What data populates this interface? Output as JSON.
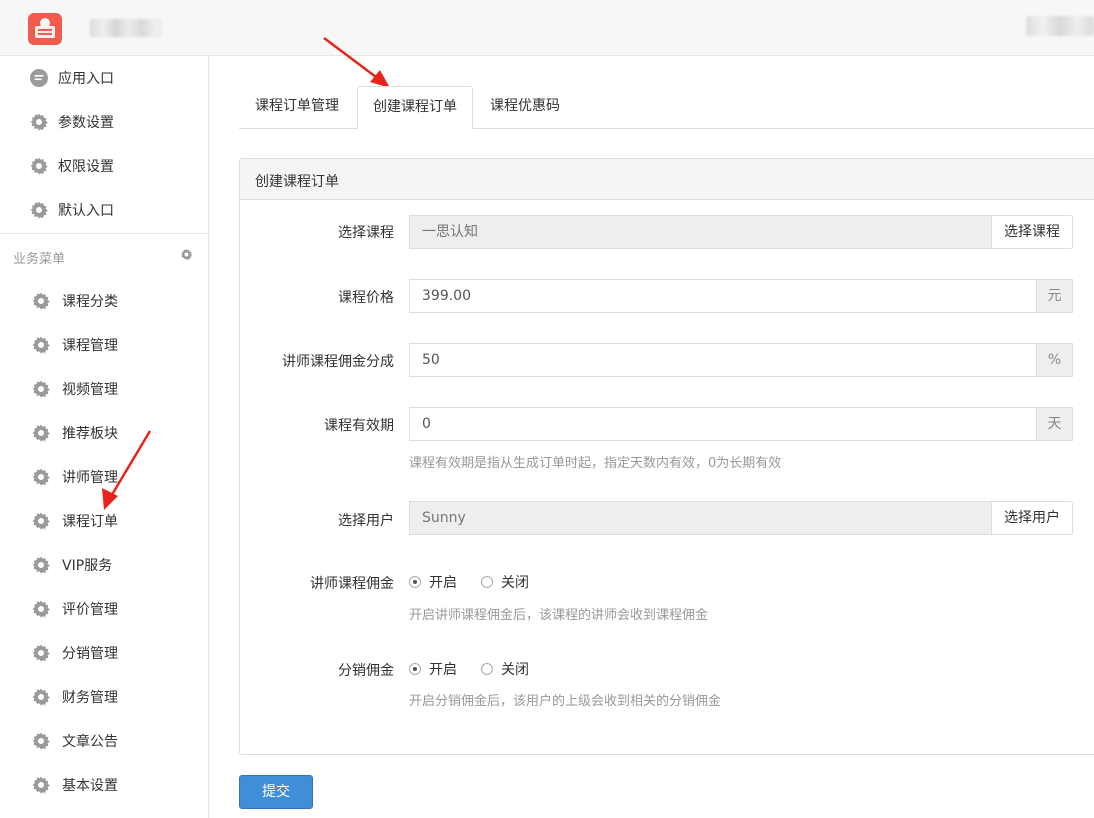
{
  "sidebar": {
    "top_items": [
      {
        "label": "应用入口",
        "icon": "chat-bubble-icon"
      },
      {
        "label": "参数设置",
        "icon": "gear-icon"
      },
      {
        "label": "权限设置",
        "icon": "gear-icon"
      },
      {
        "label": "默认入口",
        "icon": "gear-icon"
      }
    ],
    "section_title": "业务菜单",
    "business_items": [
      {
        "label": "课程分类"
      },
      {
        "label": "课程管理"
      },
      {
        "label": "视频管理"
      },
      {
        "label": "推荐板块"
      },
      {
        "label": "讲师管理"
      },
      {
        "label": "课程订单"
      },
      {
        "label": "VIP服务"
      },
      {
        "label": "评价管理"
      },
      {
        "label": "分销管理"
      },
      {
        "label": "财务管理"
      },
      {
        "label": "文章公告"
      },
      {
        "label": "基本设置"
      }
    ]
  },
  "tabs": [
    {
      "label": "课程订单管理",
      "active": false
    },
    {
      "label": "创建课程订单",
      "active": true
    },
    {
      "label": "课程优惠码",
      "active": false
    }
  ],
  "panel": {
    "title": "创建课程订单"
  },
  "form": {
    "course": {
      "label": "选择课程",
      "value": "一思认知",
      "button": "选择课程"
    },
    "price": {
      "label": "课程价格",
      "value": "399.00",
      "unit": "元"
    },
    "commission_ratio": {
      "label": "讲师课程佣金分成",
      "value": "50",
      "unit": "%"
    },
    "validity": {
      "label": "课程有效期",
      "value": "0",
      "unit": "天",
      "help": "课程有效期是指从生成订单时起，指定天数内有效，0为长期有效"
    },
    "user": {
      "label": "选择用户",
      "value": "Sunny",
      "button": "选择用户"
    },
    "teacher_commission": {
      "label": "讲师课程佣金",
      "on": "开启",
      "off": "关闭",
      "selected": "on",
      "help": "开启讲师课程佣金后，该课程的讲师会收到课程佣金"
    },
    "distribution_commission": {
      "label": "分销佣金",
      "on": "开启",
      "off": "关闭",
      "selected": "on",
      "help": "开启分销佣金后，该用户的上级会收到相关的分销佣金"
    }
  },
  "submit_label": "提交",
  "colors": {
    "primary_button": "#3e8ed8",
    "arrow": "#e8241c",
    "logo": "#f25c4e"
  }
}
